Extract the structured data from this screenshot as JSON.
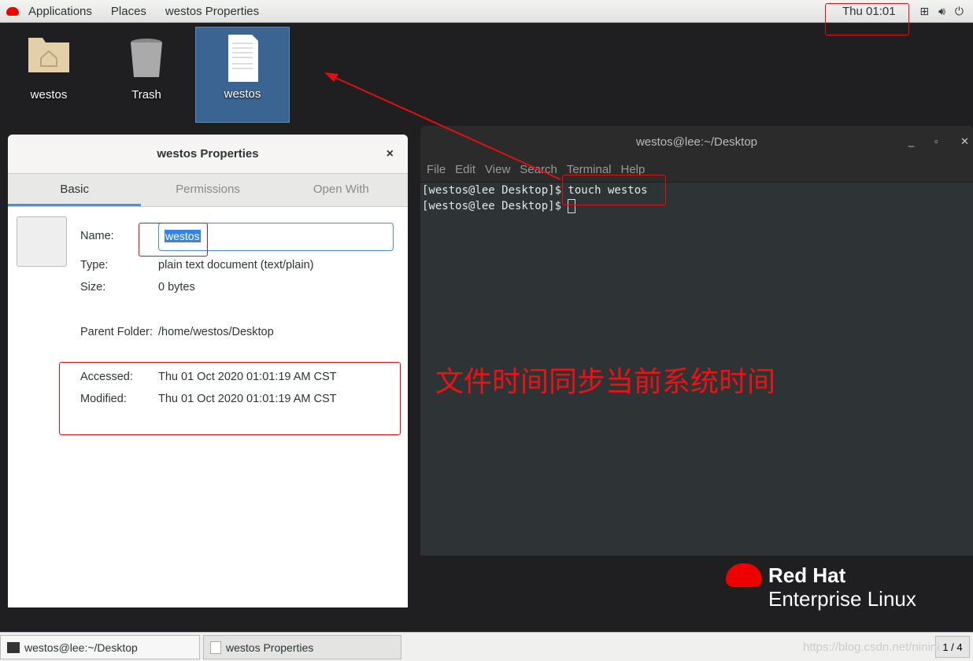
{
  "topbar": {
    "applications": "Applications",
    "places": "Places",
    "active_window": "westos Properties",
    "clock": "Thu 01:01"
  },
  "desktop": {
    "icons": [
      {
        "label": "westos",
        "icon": "home-folder-icon"
      },
      {
        "label": "Trash",
        "icon": "trash-icon"
      },
      {
        "label": "westos",
        "icon": "text-file-icon"
      }
    ]
  },
  "properties": {
    "title": "westos Properties",
    "tabs": [
      "Basic",
      "Permissions",
      "Open With"
    ],
    "fields": {
      "name_label": "Name:",
      "name_value": "westos",
      "type_label": "Type:",
      "type_value": "plain text document (text/plain)",
      "size_label": "Size:",
      "size_value": "0 bytes",
      "parent_label": "Parent Folder:",
      "parent_value": "/home/westos/Desktop",
      "accessed_label": "Accessed:",
      "accessed_value": "Thu 01 Oct 2020 01:01:19 AM CST",
      "modified_label": "Modified:",
      "modified_value": "Thu 01 Oct 2020 01:01:19 AM CST"
    }
  },
  "terminal": {
    "title": "westos@lee:~/Desktop",
    "menu": [
      "File",
      "Edit",
      "View",
      "Search",
      "Terminal",
      "Help"
    ],
    "line1": "[westos@lee Desktop]$ touch westos",
    "line2": "[westos@lee Desktop]$ "
  },
  "annotation": {
    "text": "文件时间同步当前系统时间",
    "color": "#e01010"
  },
  "logo": {
    "line1": "Red Hat",
    "line2": "Enterprise Linux"
  },
  "taskbar": {
    "items": [
      "westos@lee:~/Desktop",
      "westos Properties"
    ],
    "workspace": "1 / 4",
    "watermark": "https://blog.csdn.net/ninini"
  }
}
